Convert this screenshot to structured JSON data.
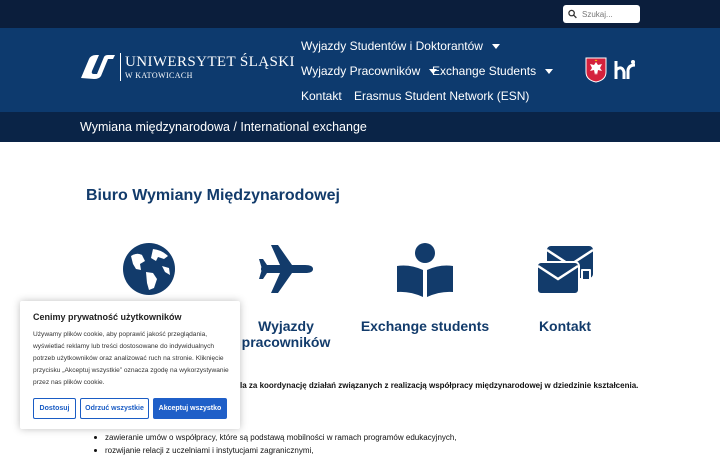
{
  "search": {
    "placeholder": "Szukaj..."
  },
  "logo": {
    "name": "UNIWERSYTET ŚLĄSKI",
    "city": "W KATOWICACH"
  },
  "nav": {
    "students": "Wyjazdy Studentów i Doktorantów",
    "staff": "Wyjazdy Pracowników",
    "exchange": "Exchange Students",
    "contact": "Kontakt",
    "esn": "Erasmus Student Network (ESN)"
  },
  "subbar": {
    "title": "Wymiana międzynarodowa / International exchange"
  },
  "page": {
    "title": "Biuro Wymiany Międzynarodowej"
  },
  "cards": {
    "staff": {
      "line1": "Wyjazdy",
      "line2": "pracowników"
    },
    "exchange": "Exchange students",
    "contact": "Kontakt"
  },
  "body": {
    "intro_tail": "la za koordynację działań związanych z realizacją współpracy międzynarodowej w dziedzinie kształcenia.",
    "bullets": [
      "zawieranie umów o współpracy, które są podstawą mobilności w ramach programów edukacyjnych,",
      "rozwijanie relacji z uczelniami i instytucjami zagranicznymi,"
    ]
  },
  "cookie": {
    "title": "Cenimy prywatność użytkowników",
    "text": "Używamy plików cookie, aby poprawić jakość przeglądania, wyświetlać reklamy lub treści dostosowane do indywidualnych potrzeb użytkowników oraz analizować ruch na stronie. Kliknięcie przycisku „Akceptuj wszystkie” oznacza zgodę na wykorzystywanie przez nas plików cookie.",
    "customize": "Dostosuj",
    "reject": "Odrzuć wszystkie",
    "accept": "Akceptuj wszystko"
  },
  "colors": {
    "topbar": "#0b1e3c",
    "header": "#0d3a6e",
    "subbar": "#0a2447",
    "accent": "#123b6b",
    "button": "#1f5fc8"
  }
}
